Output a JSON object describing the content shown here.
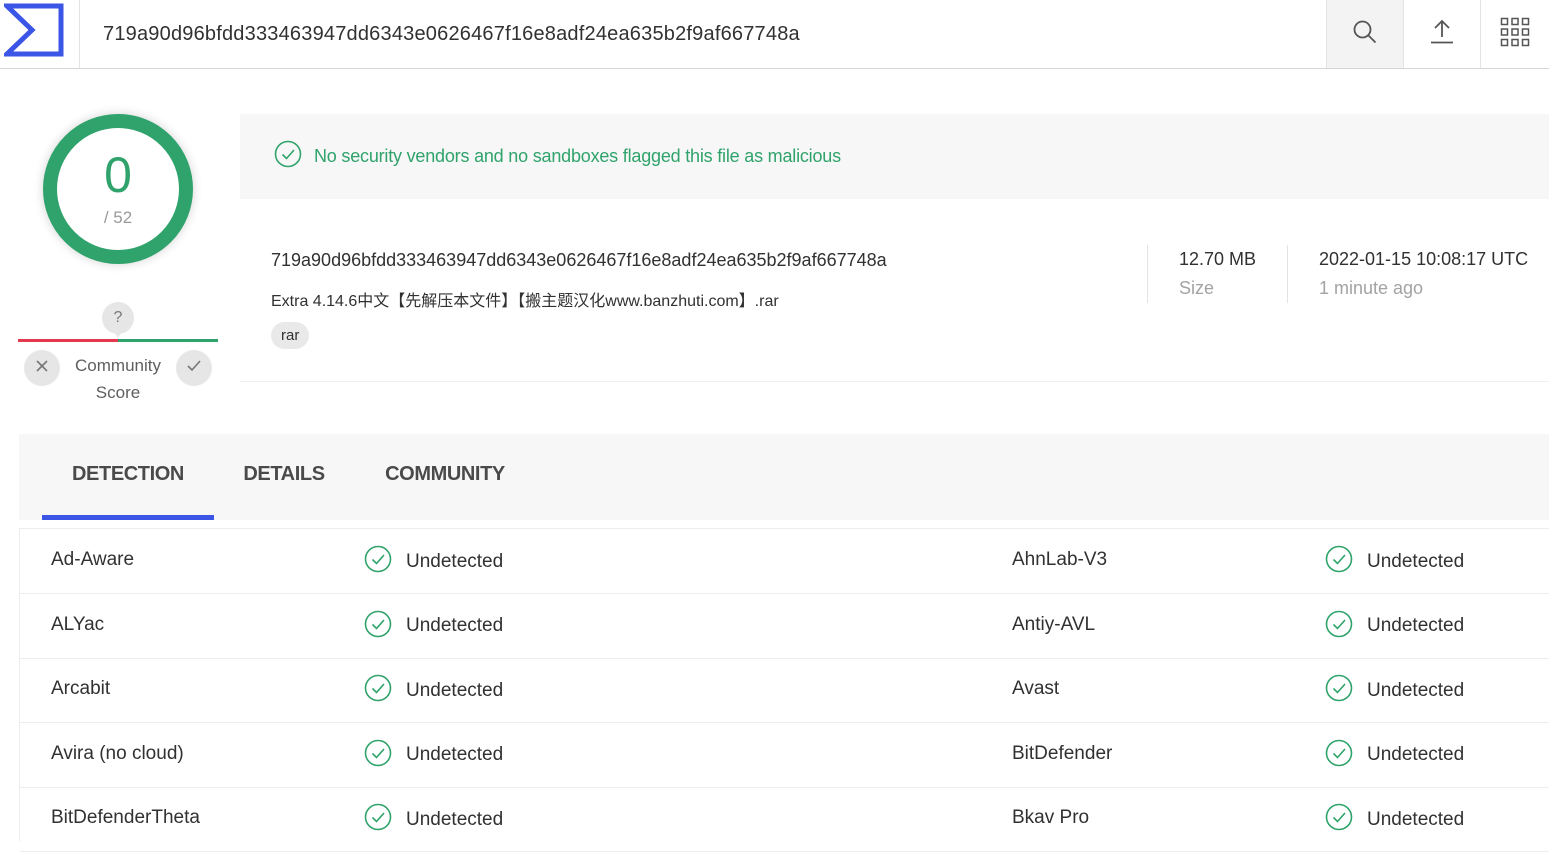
{
  "header": {
    "search_value": "719a90d96bfdd333463947dd6343e0626467f16e8adf24ea635b2f9af667748a",
    "icons": [
      "vt-logo-icon",
      "search-icon",
      "upload-icon",
      "apps-grid-icon"
    ]
  },
  "score": {
    "detections": "0",
    "total": "/ 52",
    "community_help": "?",
    "community_label": "Community Score"
  },
  "verdict": {
    "text": "No security vendors and no sandboxes flagged this file as malicious"
  },
  "file": {
    "hash": "719a90d96bfdd333463947dd6343e0626467f16e8adf24ea635b2f9af667748a",
    "name": "Extra 4.14.6中文【先解压本文件】【搬主题汉化www.banzhuti.com】.rar",
    "tag": "rar",
    "size_value": "12.70 MB",
    "size_label": "Size",
    "date_value": "2022-01-15 10:08:17 UTC",
    "date_relative": "1 minute ago"
  },
  "tabs": [
    {
      "label": "DETECTION",
      "active": true
    },
    {
      "label": "DETAILS",
      "active": false
    },
    {
      "label": "COMMUNITY",
      "active": false
    }
  ],
  "detections": [
    {
      "left": {
        "vendor": "Ad-Aware",
        "result": "Undetected"
      },
      "right": {
        "vendor": "AhnLab-V3",
        "result": "Undetected"
      }
    },
    {
      "left": {
        "vendor": "ALYac",
        "result": "Undetected"
      },
      "right": {
        "vendor": "Antiy-AVL",
        "result": "Undetected"
      }
    },
    {
      "left": {
        "vendor": "Arcabit",
        "result": "Undetected"
      },
      "right": {
        "vendor": "Avast",
        "result": "Undetected"
      }
    },
    {
      "left": {
        "vendor": "Avira (no cloud)",
        "result": "Undetected"
      },
      "right": {
        "vendor": "BitDefender",
        "result": "Undetected"
      }
    },
    {
      "left": {
        "vendor": "BitDefenderTheta",
        "result": "Undetected"
      },
      "right": {
        "vendor": "Bkav Pro",
        "result": "Undetected"
      }
    }
  ],
  "colors": {
    "clean_green": "#2fa36b",
    "malicious_red": "#e5384f",
    "brand_blue": "#3b55e6"
  }
}
